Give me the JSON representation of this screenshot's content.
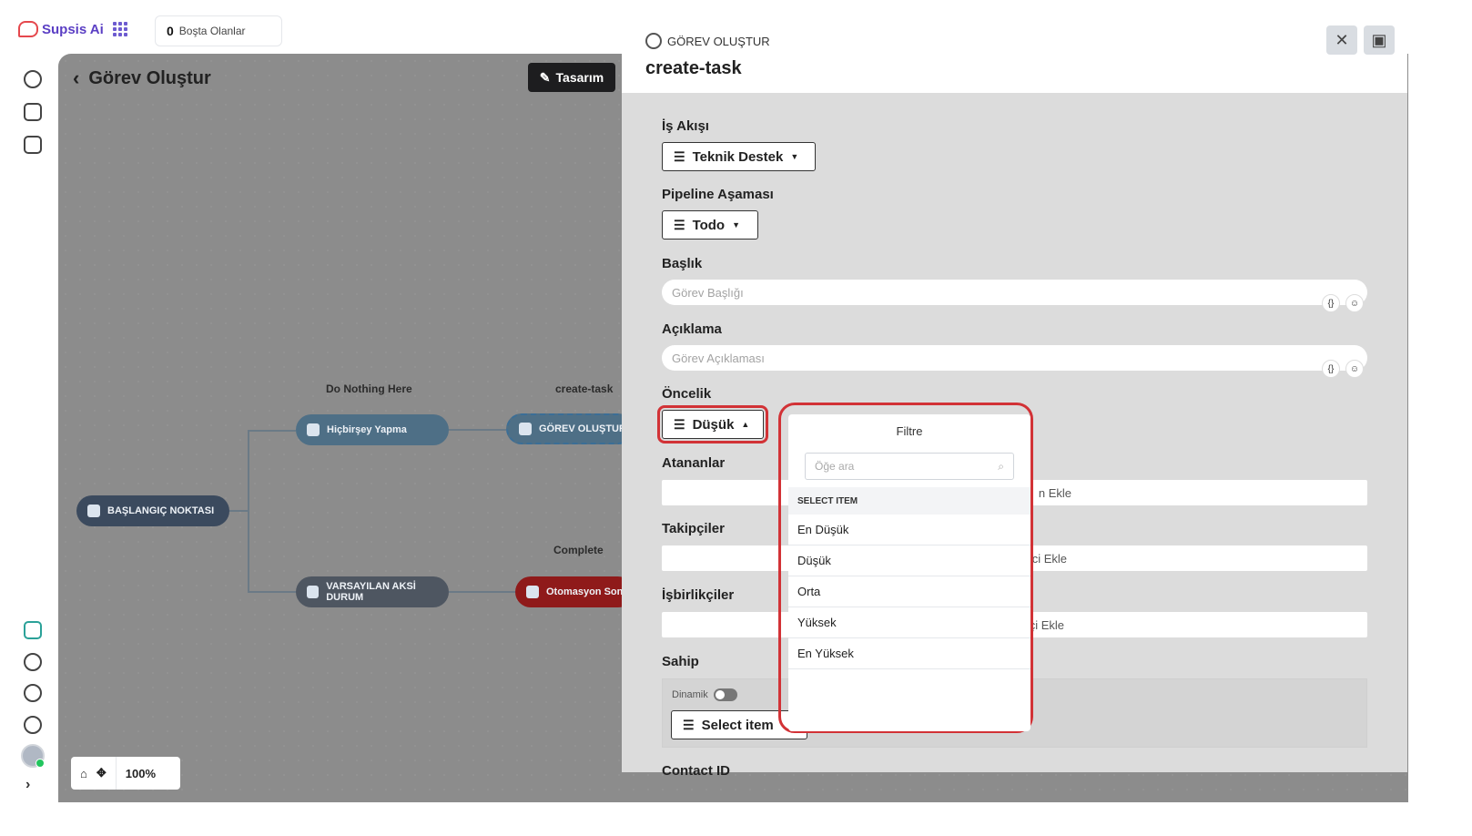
{
  "brand": {
    "name": "Supsis Ai"
  },
  "topbar": {
    "idle_count": "0",
    "idle_label": "Boşta Olanlar"
  },
  "canvas": {
    "title": "Görev Oluştur",
    "design_button": "Tasarım",
    "zoom": "100%",
    "nodes": {
      "start": "BAŞLANGIÇ NOKTASI",
      "nothing": "Hiçbirşey Yapma",
      "nothing_label": "Do Nothing Here",
      "default": "VARSAYILAN AKSİ DURUM",
      "task": "GÖREV OLUŞTUR",
      "task_label": "create-task",
      "end": "Otomasyon Sonl",
      "end_label": "Complete"
    }
  },
  "panel": {
    "subtitle": "GÖREV OLUŞTUR",
    "title": "create-task",
    "fields": {
      "workflow_label": "İş Akışı",
      "workflow_value": "Teknik Destek",
      "stage_label": "Pipeline Aşaması",
      "stage_value": "Todo",
      "title_label": "Başlık",
      "title_placeholder": "Görev Başlığı",
      "desc_label": "Açıklama",
      "desc_placeholder": "Görev Açıklaması",
      "priority_label": "Öncelik",
      "priority_value": "Düşük",
      "assignees_label": "Atananlar",
      "assignees_hint": "n Ekle",
      "followers_label": "Takipçiler",
      "followers_hint": "ci Ekle",
      "collab_label": "İşbirlikçiler",
      "collab_hint": "çi Ekle",
      "owner_label": "Sahip",
      "owner_dynamic": "Dinamik",
      "owner_select": "Select item",
      "contact_label": "Contact ID"
    }
  },
  "dropdown": {
    "title": "Filtre",
    "search_placeholder": "Öğe ara",
    "section": "SELECT ITEM",
    "items": [
      "En Düşük",
      "Düşük",
      "Orta",
      "Yüksek",
      "En Yüksek"
    ]
  },
  "colors": {
    "accent": "#d23236",
    "brand": "#5b3fc4",
    "end_node": "#8f1a1a"
  }
}
